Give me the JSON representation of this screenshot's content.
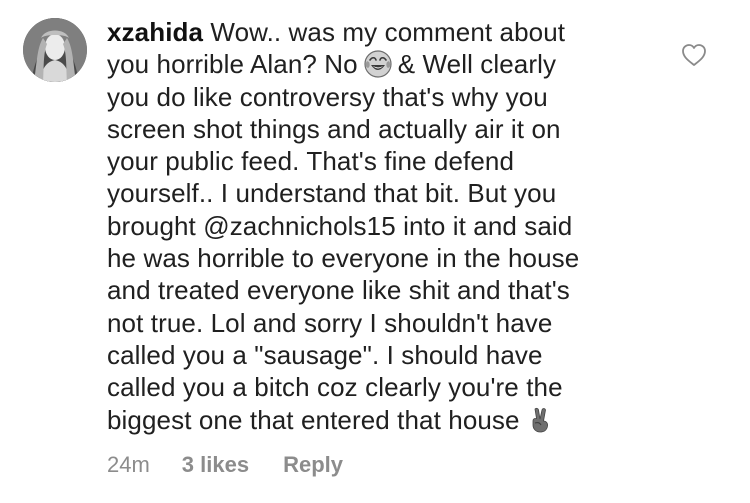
{
  "comment": {
    "username": "xzahida",
    "text_lines": [
      "Wow.. was my comment about",
      "you horrible Alan? No",
      "& Well clearly",
      "you do like controversy that's why you",
      "screen shot things and actually air it on",
      "your public feed. That's fine defend",
      "yourself.. I understand that bit. But you",
      "brought @zachnichols15 into it and said",
      "he was horrible to everyone in the house",
      "and treated everyone like shit and that's",
      "not true. Lol and sorry I shouldn't have",
      "called you a \"sausage\". I should have",
      "called you a bitch coz clearly you're the",
      "biggest one that entered that house"
    ],
    "emoji_laugh": "face-with-tears-of-joy-icon",
    "emoji_peace": "victory-hand-icon",
    "timestamp": "24m",
    "likes": "3 likes",
    "reply_label": "Reply",
    "like_icon": "heart-outline-icon"
  },
  "colors": {
    "text": "#202020",
    "meta": "#8c8c8c",
    "background": "#ffffff"
  }
}
